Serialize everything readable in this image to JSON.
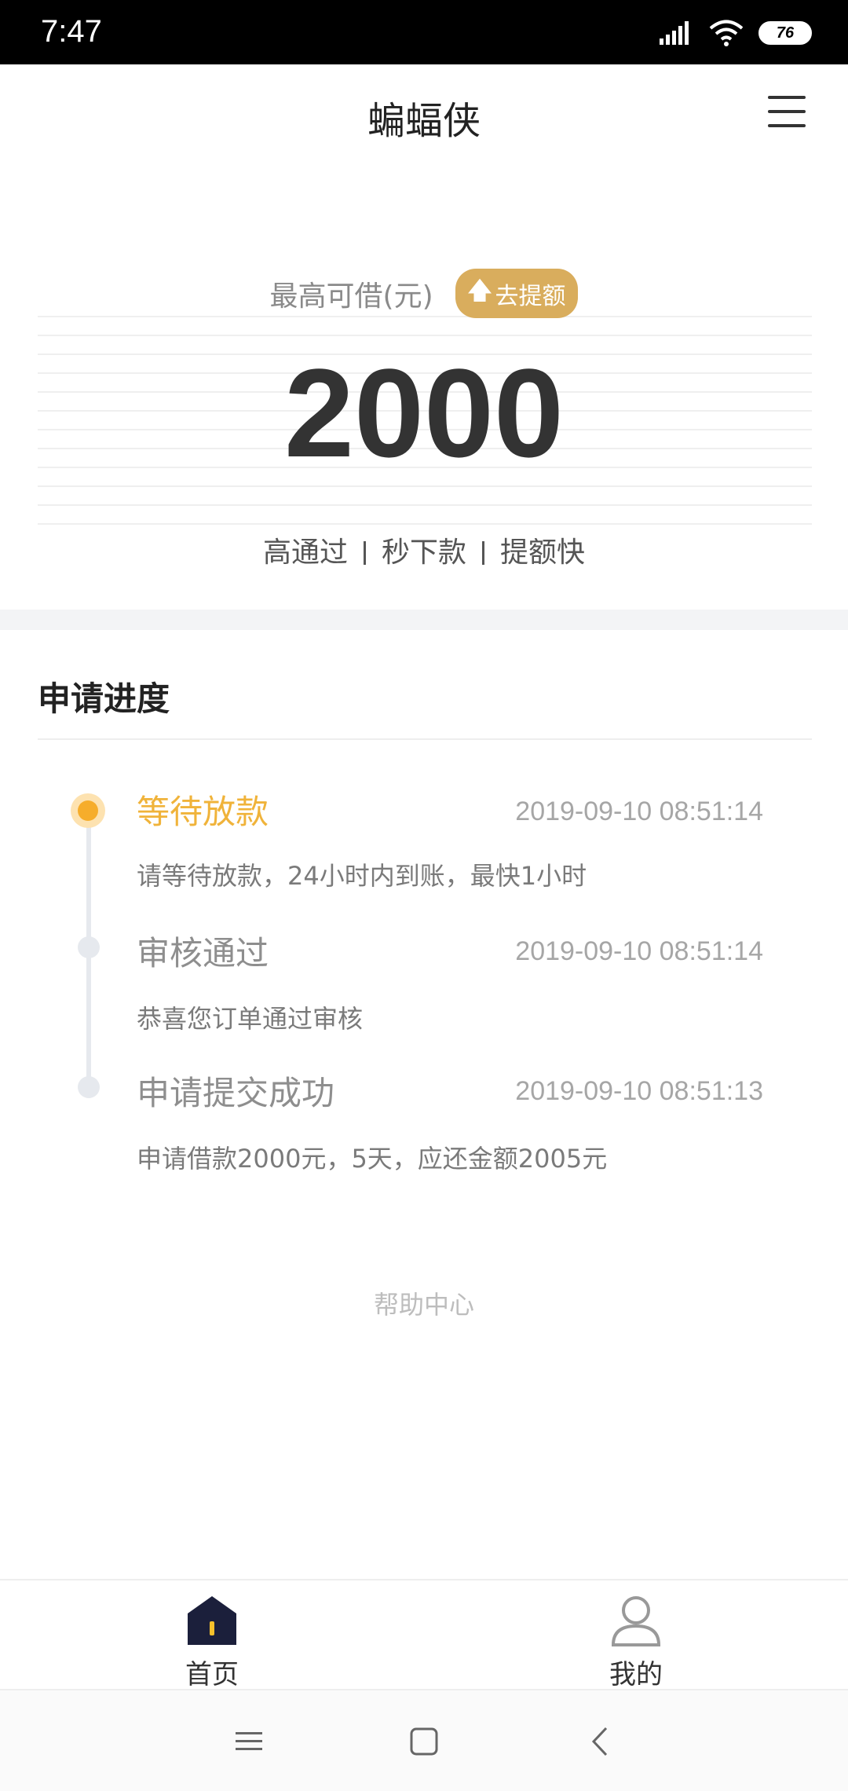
{
  "status_bar": {
    "time": "7:47",
    "battery": "76",
    "icons": [
      "signal-icon",
      "wifi-icon",
      "battery-icon"
    ]
  },
  "header": {
    "title": "蝙蝠侠",
    "menu_icon": "hamburger-menu-icon"
  },
  "hero": {
    "label": "最高可借(元)",
    "badge": "去提额",
    "badge_icon": "arrow-up-icon",
    "amount": "2000",
    "features": [
      "高通过",
      "秒下款",
      "提额快"
    ]
  },
  "progress": {
    "title": "申请进度",
    "steps": [
      {
        "title": "等待放款",
        "time": "2019-09-10 08:51:14",
        "desc": "请等待放款，24小时内到账，最快1小时",
        "active": true
      },
      {
        "title": "审核通过",
        "time": "2019-09-10 08:51:14",
        "desc": "恭喜您订单通过审核",
        "active": false
      },
      {
        "title": "申请提交成功",
        "time": "2019-09-10 08:51:13",
        "desc": "申请借款2000元，5天，应还金额2005元",
        "active": false
      }
    ]
  },
  "help": {
    "label": "帮助中心"
  },
  "tabs": [
    {
      "label": "首页",
      "icon": "home-icon"
    },
    {
      "label": "我的",
      "icon": "user-icon"
    }
  ],
  "colors": {
    "accent": "#f0b33a",
    "badge": "#d9ad5d",
    "home_icon": "#1b1f3b"
  }
}
